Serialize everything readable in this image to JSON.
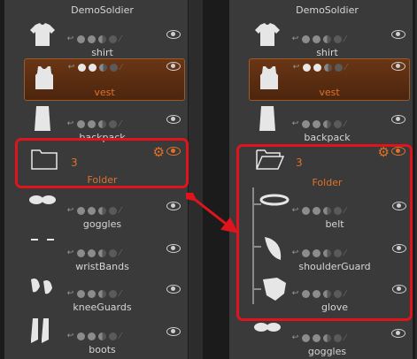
{
  "left_panel": {
    "items": [
      {
        "name": "DemoSoldier"
      },
      {
        "name": "shirt"
      },
      {
        "name": "vest"
      },
      {
        "name": "backpack"
      },
      {
        "name": "Folder",
        "count": "3"
      },
      {
        "name": "goggles"
      },
      {
        "name": "wristBands"
      },
      {
        "name": "kneeGuards"
      },
      {
        "name": "boots"
      }
    ]
  },
  "right_panel": {
    "items": [
      {
        "name": "DemoSoldier"
      },
      {
        "name": "shirt"
      },
      {
        "name": "vest"
      },
      {
        "name": "backpack"
      },
      {
        "name": "Folder",
        "count": "3"
      },
      {
        "name": "belt"
      },
      {
        "name": "shoulderGuard"
      },
      {
        "name": "glove"
      },
      {
        "name": "goggles"
      }
    ]
  },
  "colors": {
    "accent": "#e0722a",
    "highlight_border": "#e0141c",
    "panel_bg": "#3a3a3a",
    "selected_bg": "#5a2e12"
  }
}
